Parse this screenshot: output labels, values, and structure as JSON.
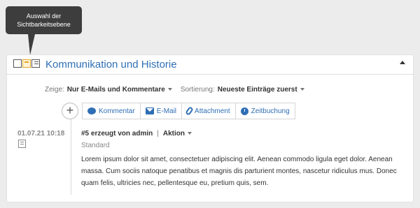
{
  "tooltip": {
    "line1": "Auswahl der",
    "line2": "Sichtbarkeitsebene"
  },
  "panel": {
    "title": "Kommunikation und Historie",
    "visibility_icons": [
      "layout-empty-icon",
      "layout-highlight-icon",
      "layout-full-icon"
    ]
  },
  "filters": {
    "show_label": "Zeige:",
    "show_value": "Nur E-Mails und Kommentare",
    "sort_label": "Sortierung:",
    "sort_value": "Neueste Einträge zuerst"
  },
  "toolbar": {
    "add": "+",
    "comment": "Kommentar",
    "email": "E-Mail",
    "attachment": "Attachment",
    "time_booking": "Zeitbuchung"
  },
  "entry": {
    "date": "01.07.21 10:18",
    "title": "#5 erzeugt von admin",
    "separator": "|",
    "action": "Aktion",
    "subtitle": "Standard",
    "body": "Lorem ipsum dolor sit amet, consectetuer adipiscing elit. Aenean commodo ligula eget dolor. Aenean massa. Cum sociis natoque penatibus et magnis dis parturient montes, nascetur ridiculus mus. Donec quam felis, ultricies nec, pellentesque eu, pretium quis, sem."
  },
  "colors": {
    "accent": "#2f6fb5",
    "tooltip": "#3d3d3d",
    "highlight": "#e3a62a"
  }
}
